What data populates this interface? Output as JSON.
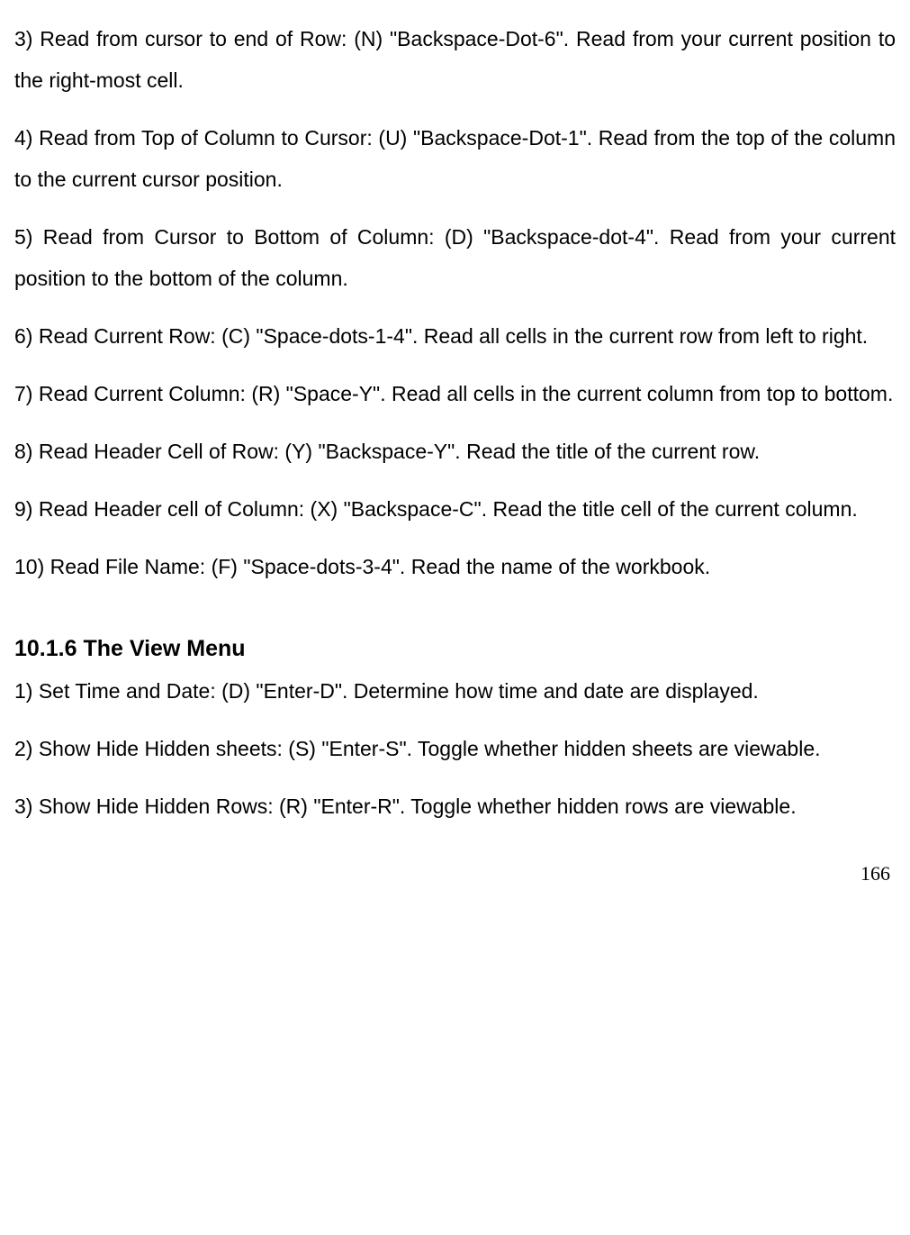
{
  "paragraphs": [
    "3) Read from cursor to end of Row: (N) \"Backspace-Dot-6\". Read from your current position to the right-most cell.",
    "4) Read from Top of Column to Cursor: (U) \"Backspace-Dot-1\". Read from the top of the column to the current cursor position.",
    "5) Read from Cursor to Bottom of Column: (D) \"Backspace-dot-4\". Read from your current position to the bottom of the column.",
    "6) Read Current Row: (C) \"Space-dots-1-4\". Read all cells in the current row from left to right.",
    "7) Read Current Column: (R) \"Space-Y\". Read all cells in the current column from top to bottom.",
    "8) Read Header Cell of Row: (Y) \"Backspace-Y\". Read the title of the current row.",
    "9) Read Header cell of Column: (X) \"Backspace-C\". Read the title cell of the current column.",
    "10) Read File Name: (F) \"Space-dots-3-4\". Read the name of the workbook."
  ],
  "heading": "10.1.6 The View Menu",
  "view_paragraphs": [
    "1) Set Time and Date: (D) \"Enter-D\". Determine how time and date are displayed.",
    "2) Show Hide Hidden sheets: (S) \"Enter-S\". Toggle whether hidden sheets are viewable.",
    "3) Show Hide Hidden Rows: (R) \"Enter-R\". Toggle whether hidden rows are viewable."
  ],
  "page_number": "166"
}
